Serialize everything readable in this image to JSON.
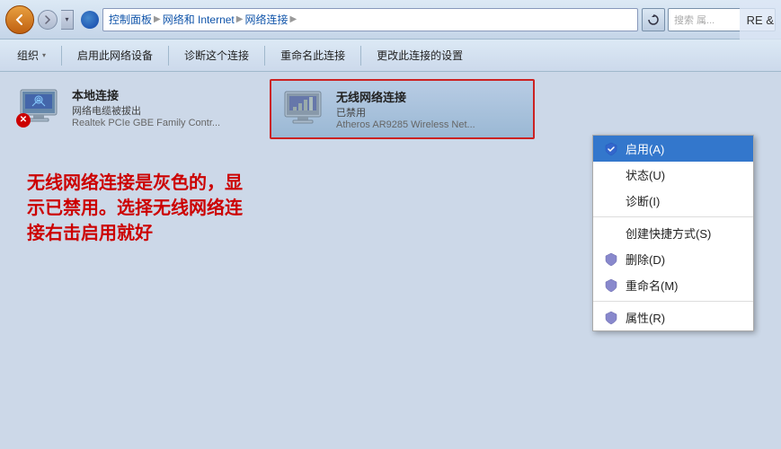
{
  "address_bar": {
    "breadcrumb": [
      "控制面板",
      "网络和 Internet",
      "网络连接"
    ],
    "search_placeholder": "搜索 属..."
  },
  "toolbar": {
    "buttons": [
      {
        "label": "组织",
        "has_dropdown": true
      },
      {
        "label": "启用此网络设备",
        "has_dropdown": false
      },
      {
        "label": "诊断这个连接",
        "has_dropdown": false
      },
      {
        "label": "重命名此连接",
        "has_dropdown": false
      },
      {
        "label": "更改此连接的设置",
        "has_dropdown": false
      }
    ]
  },
  "local_connection": {
    "name": "本地连接",
    "status": "网络电缆被拔出",
    "adapter": "Realtek PCIe GBE Family Contr..."
  },
  "wireless_connection": {
    "name": "无线网络连接",
    "status": "已禁用",
    "adapter": "Atheros AR9285 Wireless Net..."
  },
  "context_menu": {
    "items": [
      {
        "label": "启用(A)",
        "highlighted": true,
        "has_shield": true
      },
      {
        "label": "状态(U)",
        "highlighted": false,
        "has_shield": false
      },
      {
        "label": "诊断(I)",
        "highlighted": false,
        "has_shield": false
      },
      {
        "separator": true
      },
      {
        "label": "创建快捷方式(S)",
        "highlighted": false,
        "has_shield": false
      },
      {
        "label": "删除(D)",
        "highlighted": false,
        "has_shield": true
      },
      {
        "label": "重命名(M)",
        "highlighted": false,
        "has_shield": true
      },
      {
        "separator": true
      },
      {
        "label": "属性(R)",
        "highlighted": false,
        "has_shield": true
      }
    ]
  },
  "annotation": {
    "text": "无线网络连接是灰色的，显示已禁用。选择无线网络连接右击启用就好"
  },
  "top_right": {
    "text": "RE &"
  }
}
